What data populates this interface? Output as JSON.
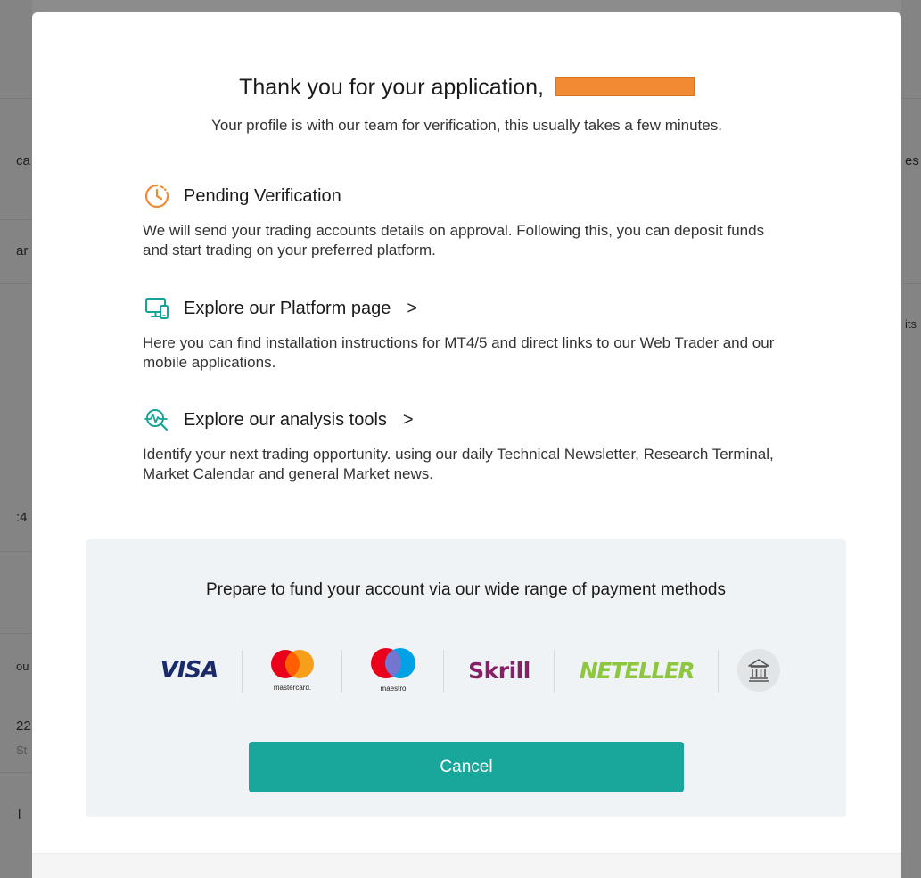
{
  "background": {
    "fragments": [
      {
        "text": "ca",
        "side": "left",
        "row": 1
      },
      {
        "text": "es",
        "side": "right",
        "row": 1
      },
      {
        "text": "ar",
        "side": "left",
        "row": 2
      },
      {
        "text": "its",
        "side": "right",
        "row": 3
      },
      {
        "text": ":4",
        "side": "left",
        "row": 4
      },
      {
        "text": "ou",
        "side": "left",
        "row": 5
      },
      {
        "text": "22",
        "side": "left",
        "row": 6
      },
      {
        "text": "St",
        "side": "left",
        "row": 7
      },
      {
        "text": "l",
        "side": "left",
        "row": 8
      }
    ]
  },
  "modal": {
    "title": "Thank you for your application,",
    "subtitle": "Your profile is with our team for verification, this usually takes a few minutes.",
    "sections": [
      {
        "icon": "clock-pending-icon",
        "heading": "Pending Verification",
        "link": false,
        "body": "We will send your trading accounts details on approval. Following this, you can deposit funds and start trading on your preferred platform."
      },
      {
        "icon": "devices-icon",
        "heading": "Explore our Platform page",
        "link": true,
        "chevron": ">",
        "body": "Here you can find installation instructions for MT4/5 and direct links to our Web Trader and our mobile applications."
      },
      {
        "icon": "analysis-chart-icon",
        "heading": "Explore our analysis tools",
        "link": true,
        "chevron": ">",
        "body": "Identify your next trading opportunity. using our daily Technical Newsletter, Research Terminal, Market Calendar and general Market news."
      }
    ],
    "funding": {
      "title": "Prepare to fund your account via our wide range of payment methods",
      "methods": [
        {
          "name": "visa",
          "label": "VISA"
        },
        {
          "name": "mastercard",
          "label": "mastercard."
        },
        {
          "name": "maestro",
          "label": "maestro"
        },
        {
          "name": "skrill",
          "label": "Skrill"
        },
        {
          "name": "neteller",
          "label": "NETELLER"
        },
        {
          "name": "bank-transfer",
          "label": ""
        }
      ],
      "cancel_label": "Cancel"
    }
  },
  "colors": {
    "accent": "#1aa79b",
    "pending": "#f08b33",
    "icon_teal": "#17a398",
    "redaction": "#f08b33"
  }
}
